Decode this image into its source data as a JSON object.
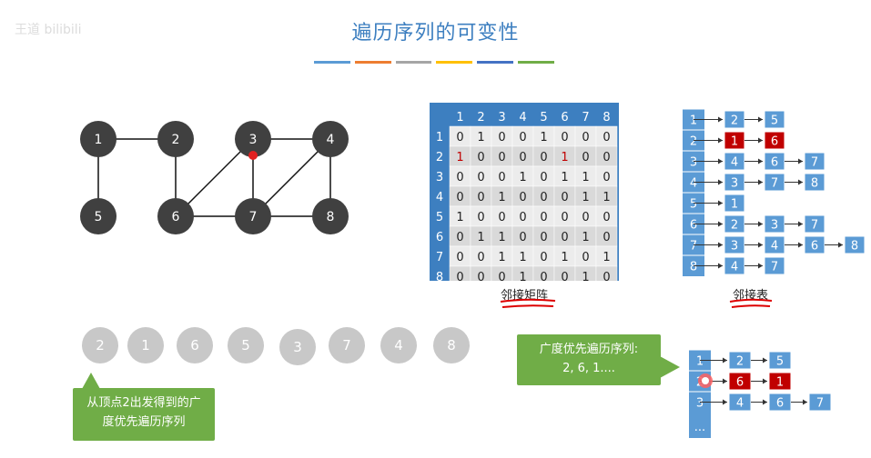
{
  "watermark": "王道   bilibili",
  "title": "遍历序列的可变性",
  "color_bars": [
    "#5b9bd5",
    "#ed7d31",
    "#a5a5a5",
    "#ffc000",
    "#4472c4",
    "#70ad47"
  ],
  "graph": {
    "vertices": [
      "1",
      "2",
      "3",
      "4",
      "5",
      "6",
      "7",
      "8"
    ],
    "edges": [
      [
        "1",
        "2"
      ],
      [
        "1",
        "5"
      ],
      [
        "2",
        "6"
      ],
      [
        "3",
        "4"
      ],
      [
        "3",
        "6"
      ],
      [
        "3",
        "7"
      ],
      [
        "4",
        "7"
      ],
      [
        "4",
        "8"
      ],
      [
        "6",
        "7"
      ],
      [
        "7",
        "8"
      ]
    ]
  },
  "matrix": {
    "headers": [
      "1",
      "2",
      "3",
      "4",
      "5",
      "6",
      "7",
      "8"
    ],
    "rows": [
      {
        "label": "1",
        "values": [
          "0",
          "1",
          "0",
          "0",
          "1",
          "0",
          "0",
          "0"
        ]
      },
      {
        "label": "2",
        "values": [
          "1",
          "0",
          "0",
          "0",
          "0",
          "1",
          "0",
          "0"
        ]
      },
      {
        "label": "3",
        "values": [
          "0",
          "0",
          "0",
          "1",
          "0",
          "1",
          "1",
          "0"
        ]
      },
      {
        "label": "4",
        "values": [
          "0",
          "0",
          "1",
          "0",
          "0",
          "0",
          "1",
          "1"
        ]
      },
      {
        "label": "5",
        "values": [
          "1",
          "0",
          "0",
          "0",
          "0",
          "0",
          "0",
          "0"
        ]
      },
      {
        "label": "6",
        "values": [
          "0",
          "1",
          "1",
          "0",
          "0",
          "0",
          "1",
          "0"
        ]
      },
      {
        "label": "7",
        "values": [
          "0",
          "0",
          "1",
          "1",
          "0",
          "1",
          "0",
          "1"
        ]
      },
      {
        "label": "8",
        "values": [
          "0",
          "0",
          "0",
          "1",
          "0",
          "0",
          "1",
          "0"
        ]
      }
    ],
    "caption": "邻接矩阵"
  },
  "adj_list": {
    "rows": [
      {
        "head": "1",
        "nodes": [
          "2",
          "5"
        ]
      },
      {
        "head": "2",
        "nodes": [
          "1",
          "6"
        ]
      },
      {
        "head": "3",
        "nodes": [
          "4",
          "6",
          "7"
        ]
      },
      {
        "head": "4",
        "nodes": [
          "3",
          "7",
          "8"
        ]
      },
      {
        "head": "5",
        "nodes": [
          "1"
        ]
      },
      {
        "head": "6",
        "nodes": [
          "2",
          "3",
          "7"
        ]
      },
      {
        "head": "7",
        "nodes": [
          "3",
          "4",
          "6",
          "8"
        ]
      },
      {
        "head": "8",
        "nodes": [
          "4",
          "7"
        ]
      }
    ],
    "caption": "邻接表"
  },
  "bfs_sequence": [
    "2",
    "1",
    "6",
    "5",
    "3",
    "7",
    "4",
    "8"
  ],
  "callout_left": {
    "line1": "从顶点2出发得到的广",
    "line2": "度优先遍历序列"
  },
  "callout_right": {
    "line1": "广度优先遍历序列:",
    "line2": "2, 6, 1...."
  },
  "small_list": {
    "rows": [
      {
        "head": "1",
        "nodes": [
          "2",
          "5"
        ]
      },
      {
        "head": "2",
        "nodes": [
          "6",
          "1"
        ]
      },
      {
        "head": "3",
        "nodes": [
          "4",
          "6",
          "7"
        ]
      }
    ],
    "ellipsis": "..."
  },
  "colors": {
    "blue": "#3d7fc0",
    "node_dark": "#404040",
    "red": "#c00000",
    "green": "#70ad47"
  }
}
